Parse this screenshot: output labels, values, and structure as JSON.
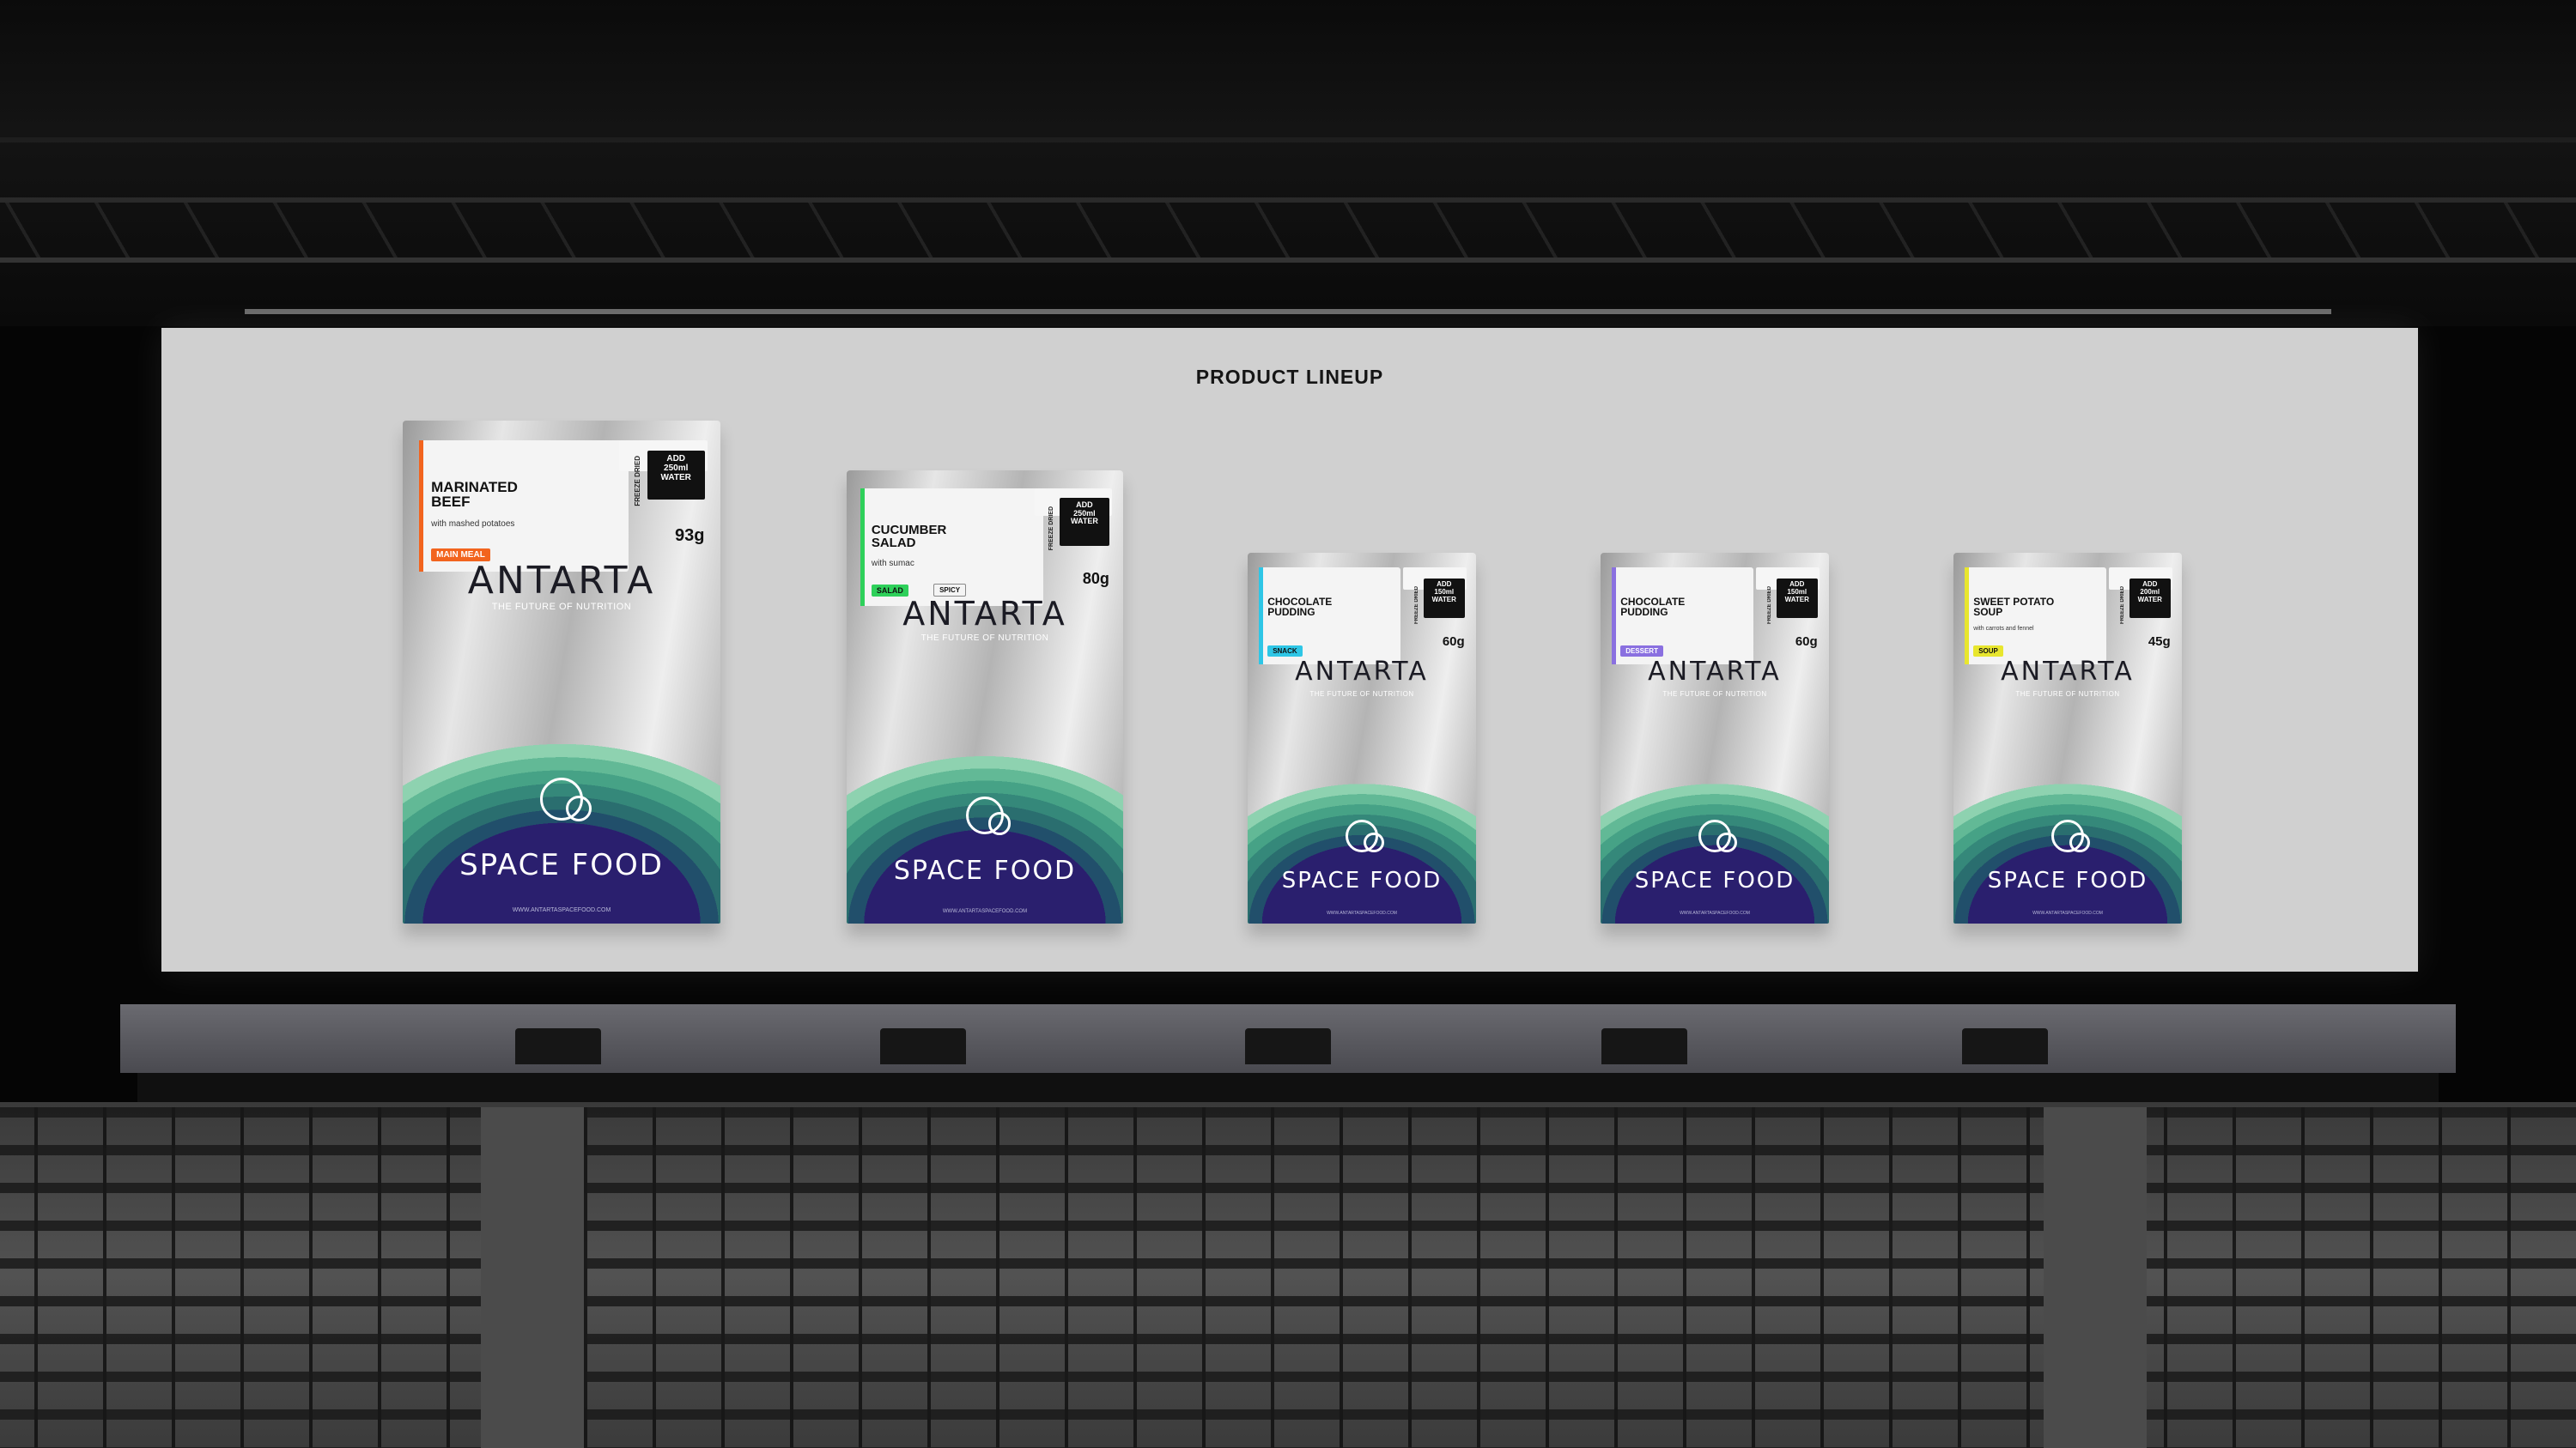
{
  "screen": {
    "title": "PRODUCT LINEUP"
  },
  "products": [
    {
      "name_line1": "MARINATED",
      "name_line2": "BEEF",
      "subtitle": "with mashed potatoes",
      "tag": "MAIN MEAL",
      "tag_color": "#f2641e",
      "extra_tag": "",
      "water_line1": "ADD",
      "water_line2": "250ml",
      "water_line3": "WATER",
      "freeze": "FREEZE DRIED",
      "weight": "93g",
      "brand": "ANTARTA",
      "tagline": "THE FUTURE OF NUTRITION",
      "product_brand": "SPACE FOOD",
      "url": "WWW.ANTARTASPACEFOOD.COM"
    },
    {
      "name_line1": "CUCUMBER",
      "name_line2": "SALAD",
      "subtitle": "with sumac",
      "tag": "SALAD",
      "tag_color": "#2ed05a",
      "extra_tag": "SPICY",
      "water_line1": "ADD",
      "water_line2": "250ml",
      "water_line3": "WATER",
      "freeze": "FREEZE DRIED",
      "weight": "80g",
      "brand": "ANTARTA",
      "tagline": "THE FUTURE OF NUTRITION",
      "product_brand": "SPACE FOOD",
      "url": "WWW.ANTARTASPACEFOOD.COM"
    },
    {
      "name_line1": "CHOCOLATE",
      "name_line2": "PUDDING",
      "subtitle": "",
      "tag": "SNACK",
      "tag_color": "#2ec6e6",
      "extra_tag": "",
      "water_line1": "ADD",
      "water_line2": "150ml",
      "water_line3": "WATER",
      "freeze": "FREEZE DRIED",
      "weight": "60g",
      "brand": "ANTARTA",
      "tagline": "THE FUTURE OF NUTRITION",
      "product_brand": "SPACE FOOD",
      "url": "WWW.ANTARTASPACEFOOD.COM"
    },
    {
      "name_line1": "CHOCOLATE",
      "name_line2": "PUDDING",
      "subtitle": "",
      "tag": "DESSERT",
      "tag_color": "#8a70e0",
      "extra_tag": "",
      "water_line1": "ADD",
      "water_line2": "150ml",
      "water_line3": "WATER",
      "freeze": "FREEZE DRIED",
      "weight": "60g",
      "brand": "ANTARTA",
      "tagline": "THE FUTURE OF NUTRITION",
      "product_brand": "SPACE FOOD",
      "url": "WWW.ANTARTASPACEFOOD.COM"
    },
    {
      "name_line1": "SWEET POTATO",
      "name_line2": "SOUP",
      "subtitle": "with carrots and fennel",
      "tag": "SOUP",
      "tag_color": "#e8e62e",
      "extra_tag": "",
      "water_line1": "ADD",
      "water_line2": "200ml",
      "water_line3": "WATER",
      "freeze": "FREEZE DRIED",
      "weight": "45g",
      "brand": "ANTARTA",
      "tagline": "THE FUTURE OF NUTRITION",
      "product_brand": "SPACE FOOD",
      "url": "WWW.ANTARTASPACEFOOD.COM"
    }
  ]
}
